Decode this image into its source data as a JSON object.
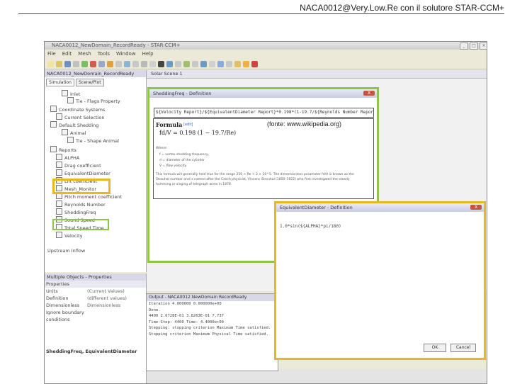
{
  "header": {
    "title": "NACA0012@Very.Low.Re con il solutore STAR-CCM+"
  },
  "app": {
    "window_title": "NACA0012_NewDomain_RecordReady - STAR-CCM+",
    "menu": [
      "File",
      "Edit",
      "Mesh",
      "Tools",
      "Window",
      "Help"
    ],
    "left_panel": {
      "title": "NACA0012_NewDomain_RecordReady",
      "tabs": [
        "Simulation",
        "Scene/Plot"
      ],
      "tree": [
        "Inlet",
        "Tie - Flags Property",
        "Coordinate Systems",
        "Current Selection",
        "Default Shedding",
        "Animal",
        "Tie - Shape Animal",
        "Reports",
        "ALPHA",
        "Drag coefficient",
        "EquivalentDiameter",
        "Lift coefficient",
        "Mesh_Monitor",
        "Pitch moment coefficient",
        "Reynolds Number",
        "SheddingFreq",
        "Sound Speed",
        "Total Speed Time",
        "Velocity",
        "Upstream Inflow"
      ]
    },
    "properties": {
      "title": "Multiple Objects - Properties",
      "section": "Properties",
      "rows": [
        {
          "key": "Units",
          "value": "(Current Values)"
        },
        {
          "key": "Definition",
          "value": "(different values)"
        },
        {
          "key": "Dimensionless",
          "value": "Dimensionless"
        },
        {
          "key": "Ignore boundary conditions",
          "value": ""
        }
      ],
      "footer": "SheddingFreq, EquivalentDiameter"
    },
    "solar_tab": "Solar Scene 1",
    "shedding_dialog": {
      "title": "SheddingFreq - Definition",
      "close": "X",
      "expression": "${Velocity Report}/${EquivalentDiameter Report}*0.198*(1-19.7/${Reynolds Number Report})",
      "source": "(fonte: www.wikipedia.org)",
      "formula_head": "Formula",
      "formula_edit": "[edit]",
      "formula": "fd/V = 0.198 (1 − 19.7/Re)",
      "where": "Where:",
      "bullets": [
        "f = vortex shedding frequency,",
        "d = diameter of the cylinder",
        "V = flow velocity."
      ],
      "text_lines": [
        "This formula will generally hold true for the range 250 < Re < 2 × 10^5. The dimensionless parameter fd/V is known as the",
        "Strouhal number and is named after the Czech physicist, Vincenc Strouhal (1850–1922) who first investigated the steady",
        "humming or singing of telegraph wires in 1878."
      ]
    },
    "equiv_dialog": {
      "title": "EquivalentDiameter - Definition",
      "close": "X",
      "expression": "1.0*sin(${ALPHA}*pi/180)",
      "ok": "OK",
      "cancel": "Cancel"
    },
    "output": {
      "title": "Output - NACA0012 NewDomain RecordReady",
      "lines": [
        "Iteration 4.000000 0.000000e+00",
        "Done.",
        "  4400  2.6728E-01  3.8263E-01  7.737",
        "Time-Step: 4400  Time: 4.4000e+00",
        "Stepping: stopping criterion Maximum Time satisfied.",
        "Stopping criterion Maximum Physical Time satisfied."
      ]
    }
  }
}
